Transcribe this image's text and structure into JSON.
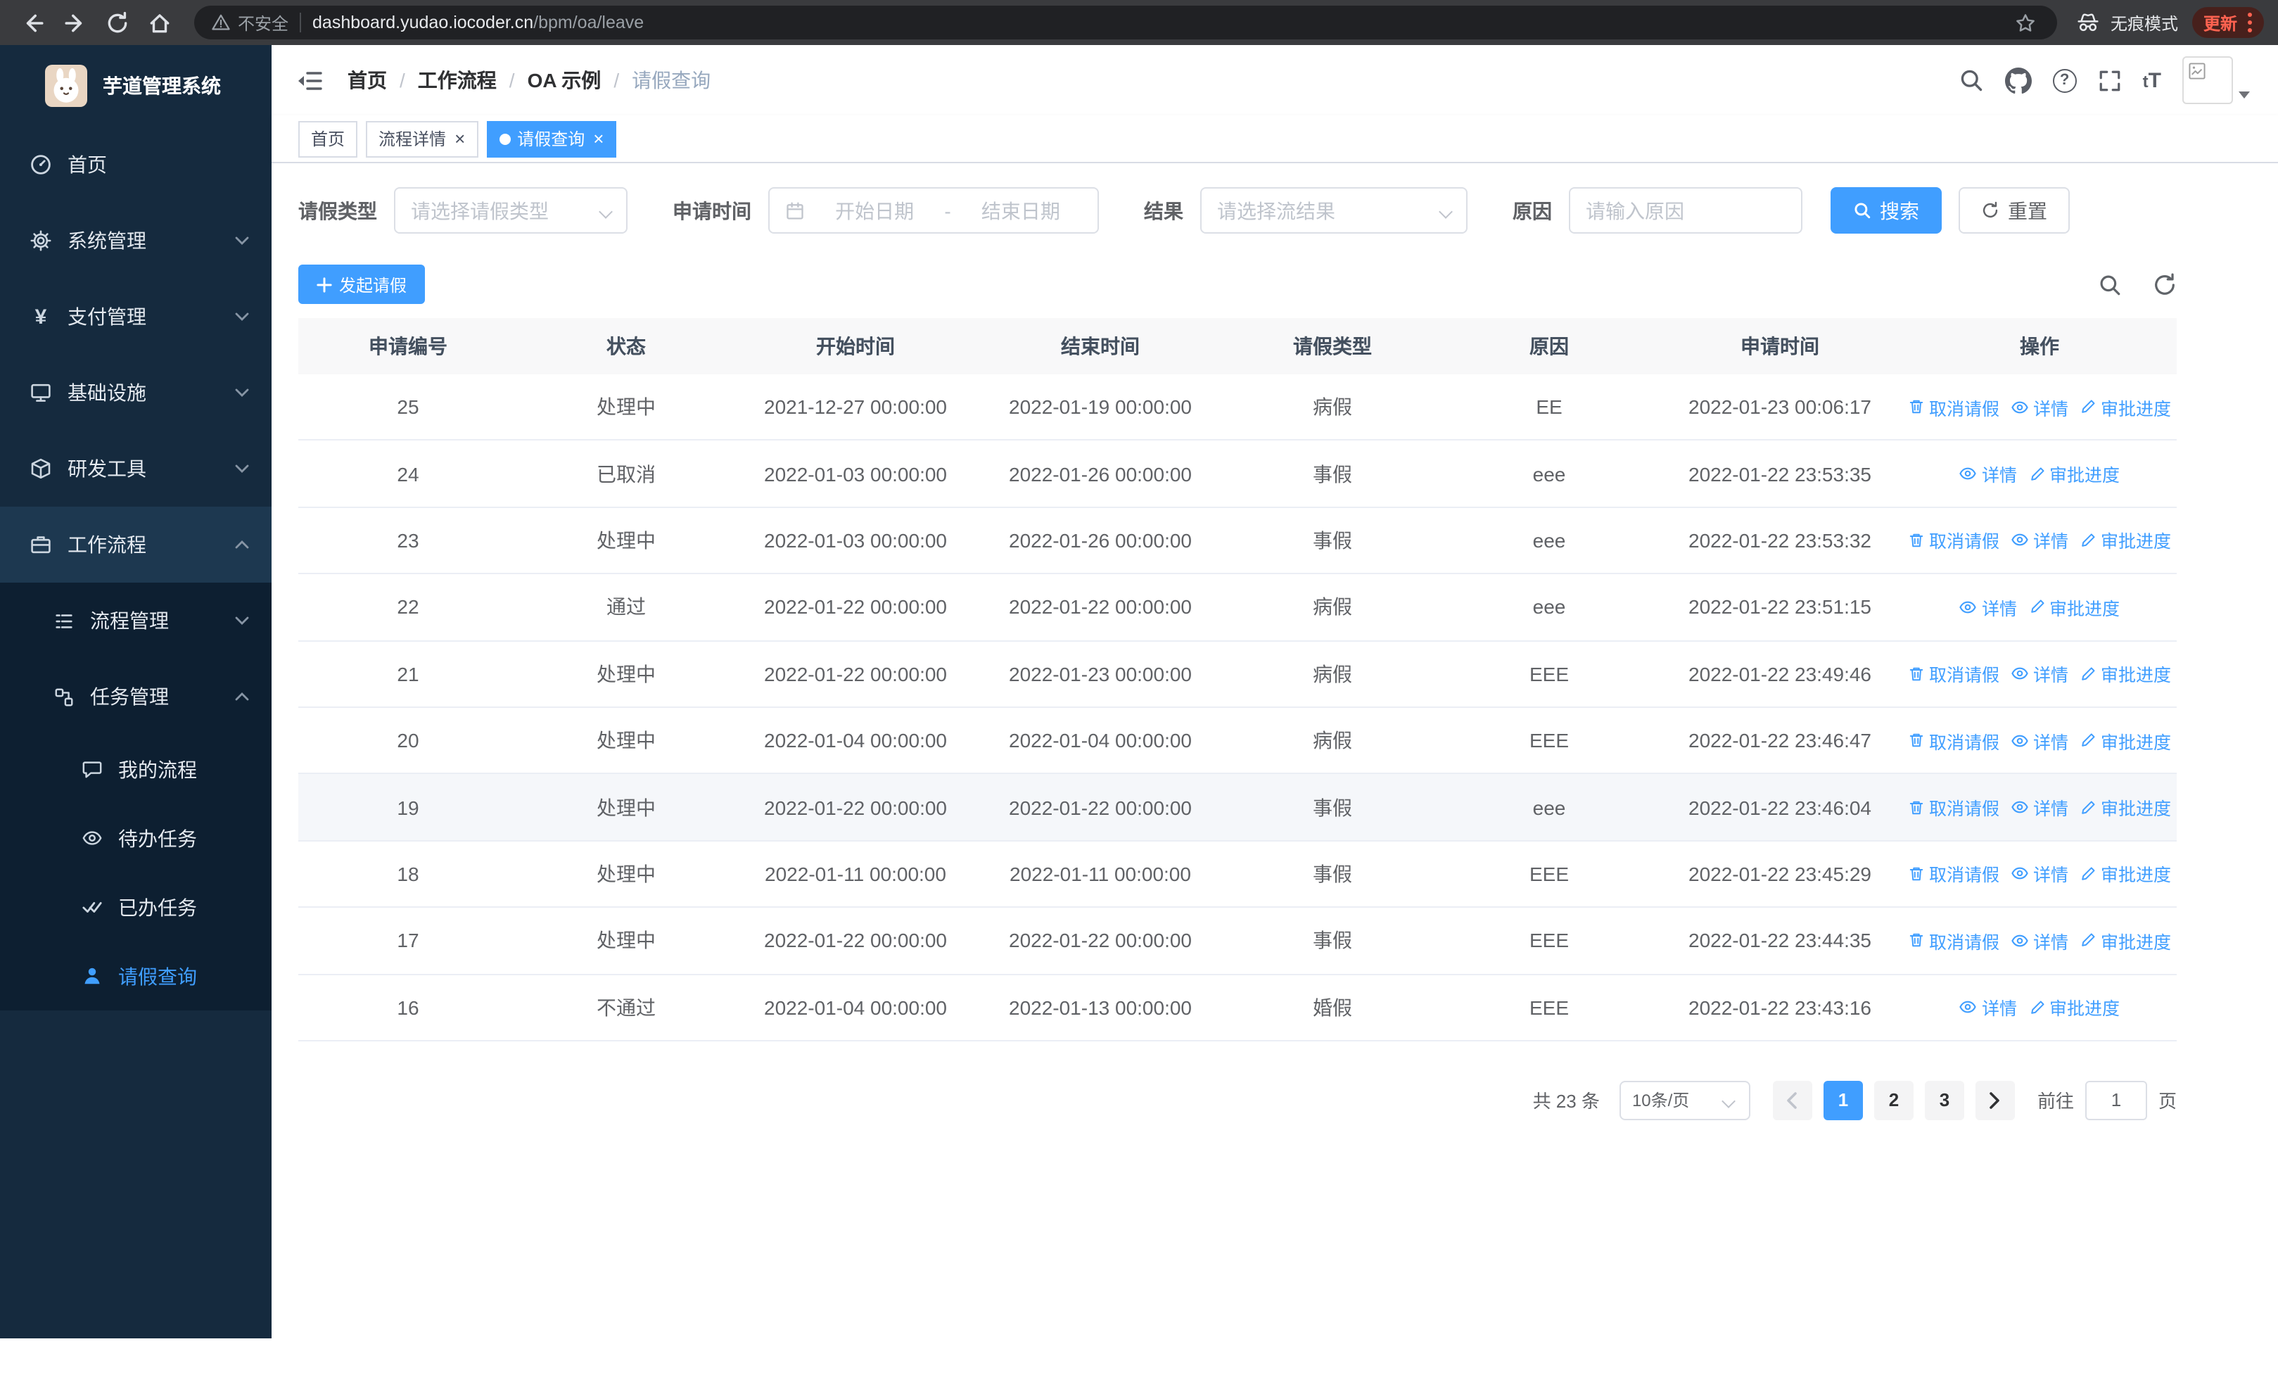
{
  "browser": {
    "security_label": "不安全",
    "url_domain": "dashboard.yudao.iocoder.cn",
    "url_path": "/bpm/oa/leave",
    "incognito_label": "无痕模式",
    "update_label": "更新"
  },
  "sidebar": {
    "logo_title": "芋道管理系统",
    "items": [
      {
        "label": "首页",
        "icon": "dashboard-icon"
      },
      {
        "label": "系统管理",
        "icon": "gear-icon"
      },
      {
        "label": "支付管理",
        "icon": "yen-icon"
      },
      {
        "label": "基础设施",
        "icon": "monitor-icon"
      },
      {
        "label": "研发工具",
        "icon": "toolbox-icon"
      },
      {
        "label": "工作流程",
        "icon": "briefcase-icon"
      }
    ],
    "workflow_children": [
      {
        "label": "流程管理",
        "icon": "list-icon"
      },
      {
        "label": "任务管理",
        "icon": "nodes-icon"
      }
    ],
    "task_children": [
      {
        "label": "我的流程",
        "icon": "chat-icon"
      },
      {
        "label": "待办任务",
        "icon": "eye-icon"
      },
      {
        "label": "已办任务",
        "icon": "double-check-icon"
      },
      {
        "label": "请假查询",
        "icon": "user-icon"
      }
    ]
  },
  "header": {
    "breadcrumb": [
      "首页",
      "工作流程",
      "OA 示例",
      "请假查询"
    ]
  },
  "tabs": [
    {
      "label": "首页"
    },
    {
      "label": "流程详情"
    },
    {
      "label": "请假查询"
    }
  ],
  "filters": {
    "leave_type_label": "请假类型",
    "leave_type_placeholder": "请选择请假类型",
    "apply_time_label": "申请时间",
    "start_date_placeholder": "开始日期",
    "range_separator": "-",
    "end_date_placeholder": "结束日期",
    "result_label": "结果",
    "result_placeholder": "请选择流结果",
    "reason_label": "原因",
    "reason_placeholder": "请输入原因",
    "search_label": "搜索",
    "reset_label": "重置"
  },
  "toolbar": {
    "create_label": "发起请假"
  },
  "table": {
    "columns": [
      "申请编号",
      "状态",
      "开始时间",
      "结束时间",
      "请假类型",
      "原因",
      "申请时间",
      "操作"
    ],
    "actions": {
      "cancel": "取消请假",
      "detail": "详情",
      "progress": "审批进度"
    },
    "rows": [
      {
        "id": "25",
        "status": "处理中",
        "start": "2021-12-27 00:00:00",
        "end": "2022-01-19 00:00:00",
        "type": "病假",
        "reason": "EE",
        "applied": "2022-01-23 00:06:17",
        "can_cancel": true,
        "hover": false
      },
      {
        "id": "24",
        "status": "已取消",
        "start": "2022-01-03 00:00:00",
        "end": "2022-01-26 00:00:00",
        "type": "事假",
        "reason": "eee",
        "applied": "2022-01-22 23:53:35",
        "can_cancel": false,
        "hover": false
      },
      {
        "id": "23",
        "status": "处理中",
        "start": "2022-01-03 00:00:00",
        "end": "2022-01-26 00:00:00",
        "type": "事假",
        "reason": "eee",
        "applied": "2022-01-22 23:53:32",
        "can_cancel": true,
        "hover": false
      },
      {
        "id": "22",
        "status": "通过",
        "start": "2022-01-22 00:00:00",
        "end": "2022-01-22 00:00:00",
        "type": "病假",
        "reason": "eee",
        "applied": "2022-01-22 23:51:15",
        "can_cancel": false,
        "hover": false
      },
      {
        "id": "21",
        "status": "处理中",
        "start": "2022-01-22 00:00:00",
        "end": "2022-01-23 00:00:00",
        "type": "病假",
        "reason": "EEE",
        "applied": "2022-01-22 23:49:46",
        "can_cancel": true,
        "hover": false
      },
      {
        "id": "20",
        "status": "处理中",
        "start": "2022-01-04 00:00:00",
        "end": "2022-01-04 00:00:00",
        "type": "病假",
        "reason": "EEE",
        "applied": "2022-01-22 23:46:47",
        "can_cancel": true,
        "hover": false
      },
      {
        "id": "19",
        "status": "处理中",
        "start": "2022-01-22 00:00:00",
        "end": "2022-01-22 00:00:00",
        "type": "事假",
        "reason": "eee",
        "applied": "2022-01-22 23:46:04",
        "can_cancel": true,
        "hover": true
      },
      {
        "id": "18",
        "status": "处理中",
        "start": "2022-01-11 00:00:00",
        "end": "2022-01-11 00:00:00",
        "type": "事假",
        "reason": "EEE",
        "applied": "2022-01-22 23:45:29",
        "can_cancel": true,
        "hover": false
      },
      {
        "id": "17",
        "status": "处理中",
        "start": "2022-01-22 00:00:00",
        "end": "2022-01-22 00:00:00",
        "type": "事假",
        "reason": "EEE",
        "applied": "2022-01-22 23:44:35",
        "can_cancel": true,
        "hover": false
      },
      {
        "id": "16",
        "status": "不通过",
        "start": "2022-01-04 00:00:00",
        "end": "2022-01-13 00:00:00",
        "type": "婚假",
        "reason": "EEE",
        "applied": "2022-01-22 23:43:16",
        "can_cancel": false,
        "hover": false
      }
    ]
  },
  "pagination": {
    "total_label": "共 23 条",
    "page_size": "10条/页",
    "pages": [
      "1",
      "2",
      "3"
    ],
    "active_page": "1",
    "goto_label": "前往",
    "goto_value": "1",
    "goto_suffix": "页"
  },
  "colors": {
    "primary": "#409eff",
    "sidebar_bg": "#152a3e",
    "submenu_bg": "#0d1f31"
  }
}
